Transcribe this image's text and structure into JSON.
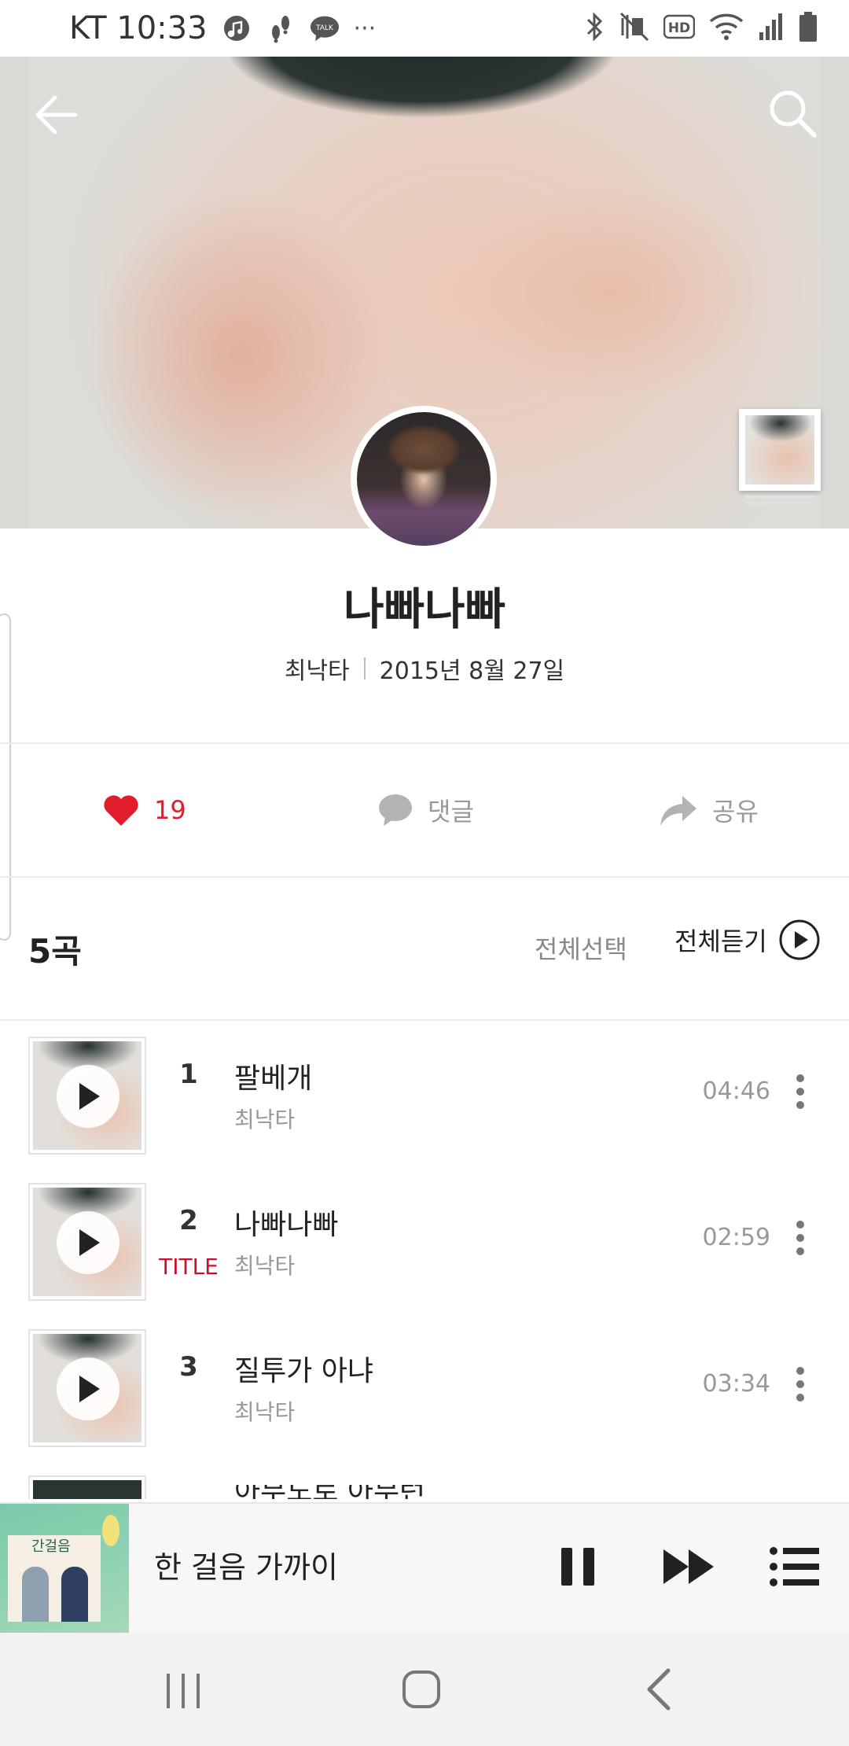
{
  "status_bar": {
    "carrier_time": "KT 10:33",
    "hd_label": "HD",
    "talk_label": "TALK",
    "more": "···"
  },
  "album": {
    "title": "나빠나빠",
    "artist": "최낙타",
    "release_date": "2015년 8월 27일"
  },
  "actions": {
    "like_count": "19",
    "comment_label": "댓글",
    "share_label": "공유"
  },
  "list": {
    "count_label": "5곡",
    "select_all_label": "전체선택",
    "play_all_label": "전체듣기"
  },
  "tracks": [
    {
      "number": "1",
      "title": "팔베개",
      "artist": "최낙타",
      "duration": "04:46",
      "badge": ""
    },
    {
      "number": "2",
      "title": "나빠나빠",
      "artist": "최낙타",
      "duration": "02:59",
      "badge": "TITLE"
    },
    {
      "number": "3",
      "title": "질투가 아냐",
      "artist": "최낙타",
      "duration": "03:34",
      "badge": ""
    }
  ],
  "partial_track": {
    "title": "아무도로 아무런"
  },
  "player": {
    "now_playing": "한 걸음 가까이",
    "art_text": "간걸음"
  },
  "colors": {
    "accent_red": "#e21d2b",
    "title_badge": "#c8102e",
    "player_art_green": "#7cc8a8"
  },
  "icons": {
    "back": "arrow-left-icon",
    "search": "search-icon",
    "like": "heart-icon",
    "comment": "speech-bubble-icon",
    "share": "share-arrow-icon",
    "play_all": "play-circle-icon",
    "track_play": "play-icon",
    "track_more": "more-vertical-icon",
    "pause": "pause-icon",
    "next": "fast-forward-icon",
    "playlist": "playlist-icon"
  }
}
